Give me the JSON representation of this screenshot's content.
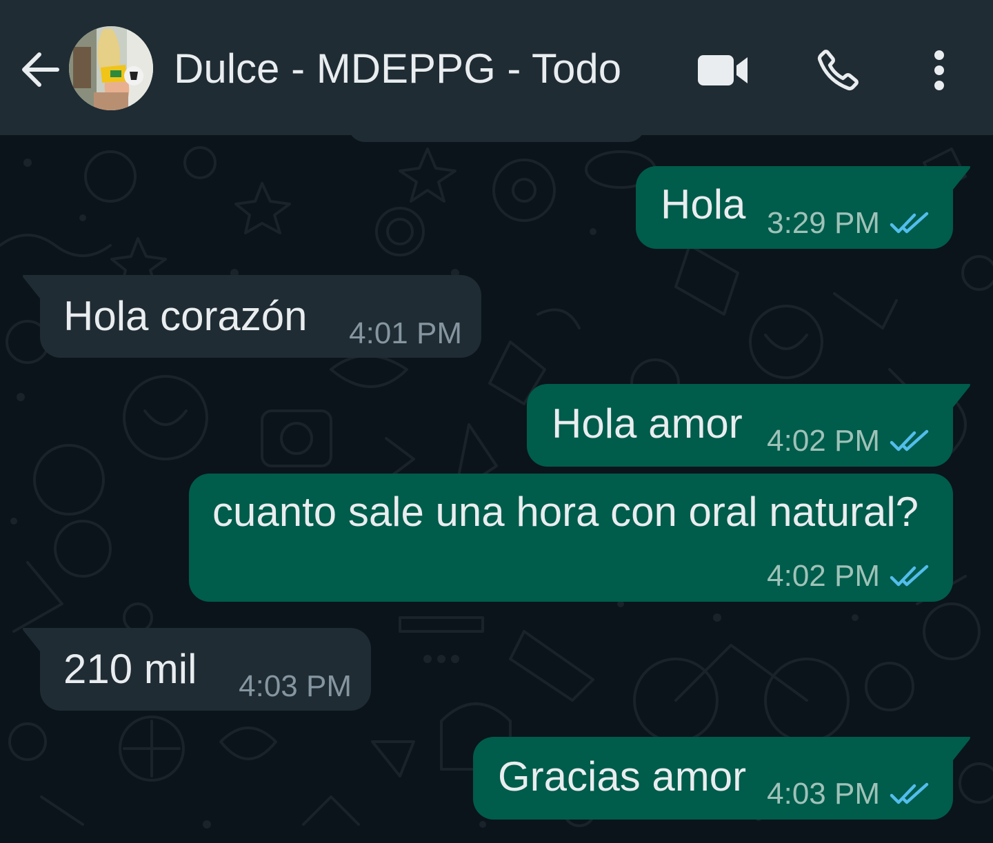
{
  "header": {
    "contact_name": "Dulce - MDEPPG - Todo",
    "back_icon": "arrow-left-icon",
    "video_icon": "video-camera-icon",
    "call_icon": "phone-icon",
    "menu_icon": "more-vertical-icon"
  },
  "colors": {
    "background": "#0b141a",
    "header": "#1f2c34",
    "outgoing_bubble": "#005c4b",
    "incoming_bubble": "#1f2c34",
    "read_ticks": "#53bdeb",
    "text": "#e9edef"
  },
  "messages": [
    {
      "direction": "outgoing",
      "text": "Hola",
      "time": "3:29 PM",
      "status": "read"
    },
    {
      "direction": "incoming",
      "text": "Hola corazón",
      "time": "4:01 PM"
    },
    {
      "direction": "outgoing",
      "text": "Hola amor",
      "time": "4:02 PM",
      "status": "read"
    },
    {
      "direction": "outgoing",
      "text": "cuanto sale una hora con oral natural?",
      "time": "4:02 PM",
      "status": "read"
    },
    {
      "direction": "incoming",
      "text": "210 mil",
      "time": "4:03 PM"
    },
    {
      "direction": "outgoing",
      "text": "Gracias amor",
      "time": "4:03 PM",
      "status": "read"
    }
  ]
}
